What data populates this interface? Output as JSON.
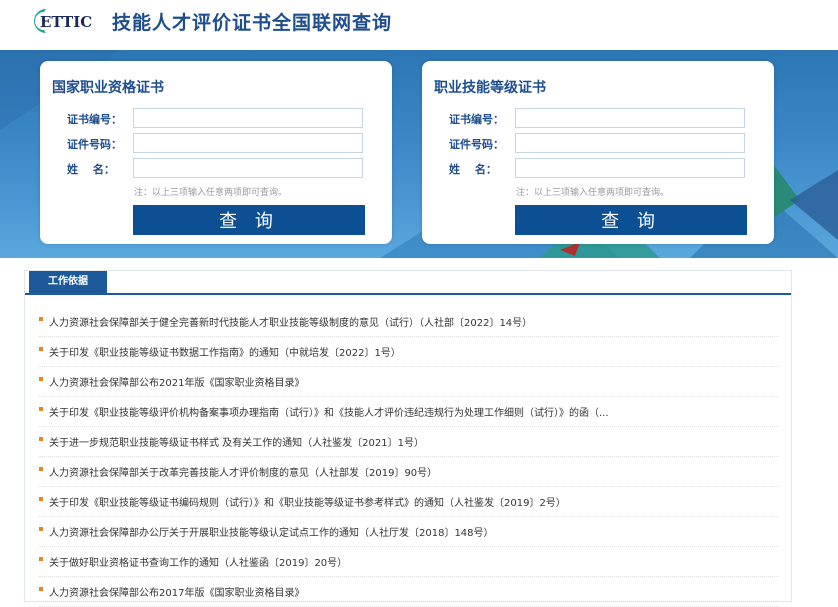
{
  "header": {
    "logo_text": "ETTIC",
    "title": "技能人才评价证书全国联网查询"
  },
  "cards": [
    {
      "title": "国家职业资格证书",
      "fields": [
        {
          "label": "证书编号：",
          "value": ""
        },
        {
          "label": "证件号码：",
          "value": ""
        },
        {
          "label": "姓　 名：",
          "value": ""
        }
      ],
      "note": "注：以上三项输入任意两项即可查询。",
      "button": "查 询"
    },
    {
      "title": "职业技能等级证书",
      "fields": [
        {
          "label": "证书编号：",
          "value": ""
        },
        {
          "label": "证件号码：",
          "value": ""
        },
        {
          "label": "姓　 名：",
          "value": ""
        }
      ],
      "note": "注：以上三项输入任意两项即可查询。",
      "button": "查 询"
    }
  ],
  "basis": {
    "tab_label": "工作依据",
    "items": [
      "人力资源社会保障部关于健全完善新时代技能人才职业技能等级制度的意见（试行）（人社部〔2022〕14号）",
      "关于印发《职业技能等级证书数据工作指南》的通知（中就培发〔2022〕1号）",
      "人力资源社会保障部公布2021年版《国家职业资格目录》",
      "关于印发《职业技能等级评价机构备案事项办理指南（试行）》和《技能人才评价违纪违规行为处理工作细则（试行）》的函（...",
      "关于进一步规范职业技能等级证书样式 及有关工作的通知（人社鉴发〔2021〕1号）",
      "人力资源社会保障部关于改革完善技能人才评价制度的意见（人社部发〔2019〕90号）",
      "关于印发《职业技能等级证书编码规则（试行）》和《职业技能等级证书参考样式》的通知（人社鉴发〔2019〕2号）",
      "人力资源社会保障部办公厅关于开展职业技能等级认定试点工作的通知（人社厅发〔2018〕148号）",
      "关于做好职业资格证书查询工作的通知（人社鉴函〔2019〕20号）",
      "人力资源社会保障部公布2017年版《国家职业资格目录》"
    ]
  },
  "colors": {
    "brand_blue": "#1f4e8e",
    "button_blue": "#0c4f93",
    "banner_blue": "#3a86c5",
    "bullet_orange": "#e08a1e",
    "logo_teal": "#23a39a"
  }
}
